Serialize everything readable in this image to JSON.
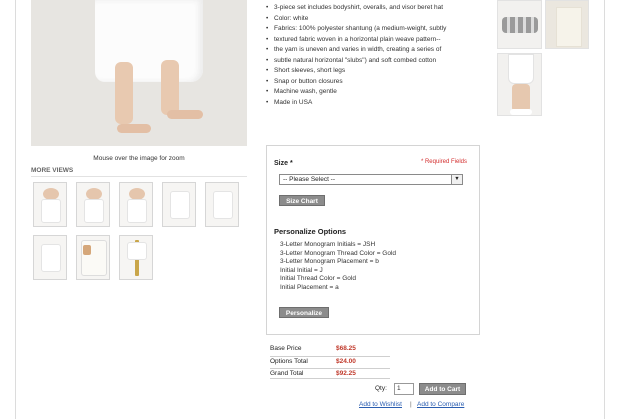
{
  "product": {
    "zoom_note": "Mouse over the image for zoom",
    "more_views_label": "MORE VIEWS",
    "description": [
      "3-piece set includes bodyshirt, overalls, and visor beret hat",
      "Color: white",
      "Fabrics: 100% polyester shantung (a medium-weight, subtly",
      "textured fabric woven in a horizontal plain weave pattern--",
      "the yarn is uneven and varies in width, creating a series of",
      "subtle natural horizontal \"slubs\") and soft combed cotton",
      "Short sleeves, short legs",
      "Snap or button closures",
      "Machine wash, gentle",
      "Made in USA"
    ]
  },
  "options": {
    "size_label": "Size *",
    "required_note": "* Required Fields",
    "size_select_value": "-- Please Select --",
    "size_chart_button": "Size Chart",
    "personalize_title": "Personalize Options",
    "personalize_lines": [
      "3-Letter Monogram Initials = JSH",
      "3-Letter Monogram Thread Color = Gold",
      "3-Letter Monogram Placement = b",
      "Initial Initial = J",
      "Initial Thread Color = Gold",
      "Initial Placement = a"
    ],
    "personalize_button": "Personalize"
  },
  "pricing": {
    "base_label": "Base Price",
    "base_value": "$68.25",
    "options_label": "Options Total",
    "options_value": "$24.00",
    "grand_label": "Grand Total",
    "grand_value": "$92.25"
  },
  "cart": {
    "qty_label": "Qty:",
    "qty_value": "1",
    "add_to_cart": "Add to Cart",
    "wishlist_link": "Add to Wishlist",
    "separator": "|",
    "compare_link": "Add to Compare"
  },
  "icons": {
    "select_arrow": "chevron-down-icon"
  }
}
